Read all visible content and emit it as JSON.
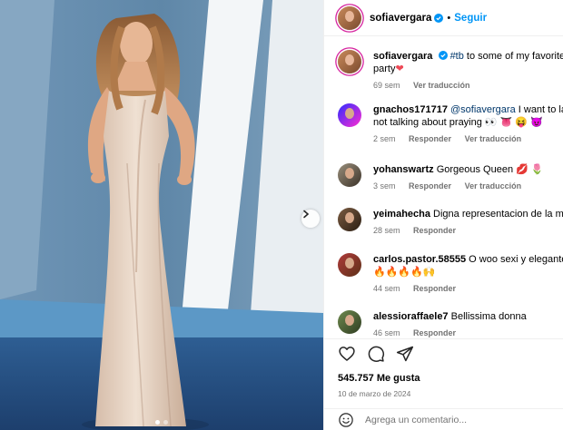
{
  "header": {
    "username": "sofiavergara",
    "separator": "•",
    "follow_label": "Seguir"
  },
  "caption": {
    "username": "sofiavergara",
    "hashtag": "#tb",
    "text": " to some of my favorite @",
    "text2": "party",
    "emoji": "❤",
    "time": "69 sem",
    "translate_label": "Ver traducción"
  },
  "comments": [
    {
      "username": "gnachos171717",
      "mention": "@sofiavergara",
      "text": " I want to lay ha",
      "text2": "not talking about praying 👀 👅 😝 😈",
      "time": "2 sem",
      "reply_label": "Responder",
      "translate_label": "Ver traducción"
    },
    {
      "username": "yohanswartz",
      "text": " Gorgeous Queen 💋 🌷",
      "time": "3 sem",
      "reply_label": "Responder",
      "translate_label": "Ver traducción"
    },
    {
      "username": "yeimahecha",
      "text": " Digna representacion de la mujer",
      "time": "28 sem",
      "reply_label": "Responder"
    },
    {
      "username": "carlos.pastor.58555",
      "text": " O woo sexi y elegante ❤",
      "text2": "🔥🔥🔥🔥🙌",
      "time": "44 sem",
      "reply_label": "Responder"
    },
    {
      "username": "alessioraffaele7",
      "text": " Bellissima donna",
      "time": "46 sem",
      "reply_label": "Responder"
    }
  ],
  "actions": {
    "likes": "545.757 Me gusta",
    "date": "10 de marzo de 2024"
  },
  "add_comment": {
    "placeholder": "Agrega un comentario..."
  },
  "colors": {
    "link": "#0095f6",
    "mention": "#00376b",
    "muted": "#737373",
    "heart": "#ed4956"
  },
  "icons": [
    "heart-icon",
    "comment-icon",
    "share-icon",
    "emoji-icon",
    "verified-badge-icon",
    "chevron-right-icon"
  ]
}
